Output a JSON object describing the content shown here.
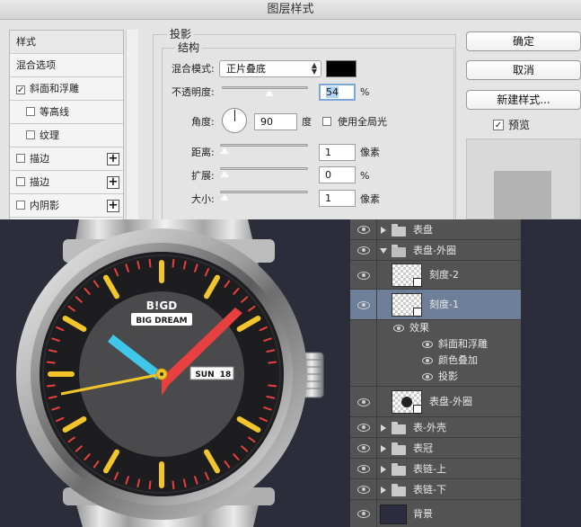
{
  "dialog": {
    "title": "图层样式",
    "style_list": [
      {
        "label": "样式",
        "checkbox": false,
        "checked": false,
        "plus": false,
        "indent": false,
        "selected": false
      },
      {
        "label": "混合选项",
        "checkbox": false,
        "checked": false,
        "plus": false,
        "indent": false,
        "selected": false
      },
      {
        "label": "斜面和浮雕",
        "checkbox": true,
        "checked": true,
        "plus": false,
        "indent": false,
        "selected": false
      },
      {
        "label": "等高线",
        "checkbox": true,
        "checked": false,
        "plus": false,
        "indent": true,
        "selected": false
      },
      {
        "label": "纹理",
        "checkbox": true,
        "checked": false,
        "plus": false,
        "indent": true,
        "selected": false
      },
      {
        "label": "描边",
        "checkbox": true,
        "checked": false,
        "plus": true,
        "indent": false,
        "selected": false
      },
      {
        "label": "描边",
        "checkbox": true,
        "checked": false,
        "plus": true,
        "indent": false,
        "selected": false
      },
      {
        "label": "内阴影",
        "checkbox": true,
        "checked": false,
        "plus": true,
        "indent": false,
        "selected": false
      }
    ],
    "drop_shadow": {
      "section_title": "投影",
      "structure_title": "结构",
      "blend_mode_label": "混合模式:",
      "blend_mode_value": "正片叠底",
      "blend_color": "#000000",
      "opacity_label": "不透明度:",
      "opacity_value": "54",
      "opacity_unit": "%",
      "opacity_fraction": 0.54,
      "angle_label": "角度:",
      "angle_value": "90",
      "angle_unit": "度",
      "global_light_label": "使用全局光",
      "global_light_checked": false,
      "distance_label": "距离:",
      "distance_value": "1",
      "distance_unit": "像素",
      "spread_label": "扩展:",
      "spread_value": "0",
      "spread_unit": "%",
      "size_label": "大小:",
      "size_value": "1",
      "size_unit": "像素"
    },
    "buttons": {
      "ok": "确定",
      "cancel": "取消",
      "new_style": "新建样式...",
      "preview_label": "预览",
      "preview_checked": true
    }
  },
  "watch": {
    "brand": "B!GD",
    "model": "BIG DREAM",
    "day": "SUN",
    "date": "18",
    "colors": {
      "hour_hand": "#3ec7e8",
      "minute_hand": "#e8403f",
      "second_hand": "#f2c52a",
      "marker": "#f2c52a",
      "minute_tick": "#e8403f",
      "dial": "#1d1d1f",
      "inner_dial": "#4a4a4c"
    }
  },
  "layers": {
    "rows": [
      {
        "type": "group",
        "name": "表盘",
        "expanded": false
      },
      {
        "type": "group",
        "name": "表盘-外圈",
        "expanded": true
      },
      {
        "type": "layer",
        "name": "刻度-2"
      },
      {
        "type": "layer",
        "name": "刻度-1",
        "selected": true
      },
      {
        "type": "effects",
        "name": "效果"
      },
      {
        "type": "effect",
        "name": "斜面和浮雕"
      },
      {
        "type": "effect",
        "name": "颜色叠加"
      },
      {
        "type": "effect",
        "name": "投影"
      },
      {
        "type": "layer",
        "name": "表盘-外圈",
        "dot": true
      },
      {
        "type": "group",
        "name": "表-外壳",
        "expanded": false
      },
      {
        "type": "group",
        "name": "表冠",
        "expanded": false
      },
      {
        "type": "group",
        "name": "表链-上",
        "expanded": false
      },
      {
        "type": "group",
        "name": "表链-下",
        "expanded": false
      },
      {
        "type": "background",
        "name": "背景"
      }
    ]
  }
}
